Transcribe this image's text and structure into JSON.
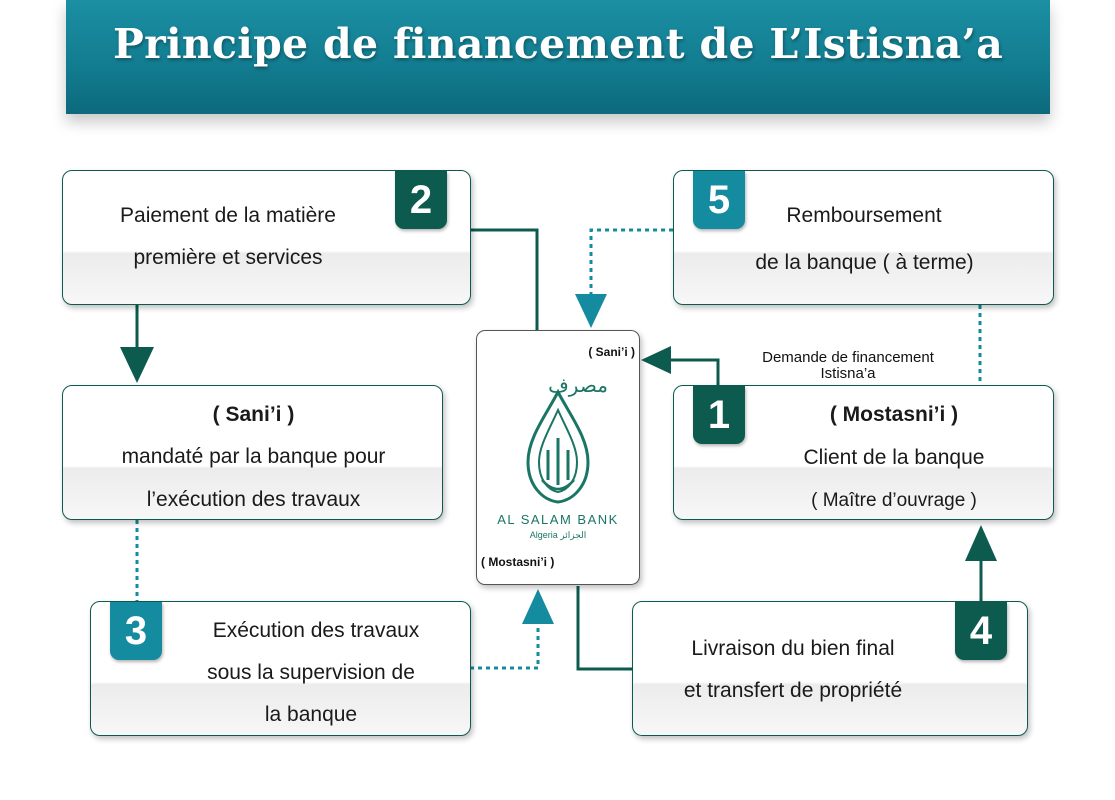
{
  "title": "Principe de financement de L’Istisna’a",
  "colors": {
    "banner": "#137d91",
    "dark_green": "#0d5b4e",
    "teal": "#158ba0"
  },
  "steps": {
    "s1": {
      "number": "1",
      "title": "( Mostasni’i )",
      "line1": "Client de la banque",
      "line2": "( Maître d’ouvrage )"
    },
    "s2": {
      "number": "2",
      "line1": "Paiement de la matière",
      "line2": "première et services"
    },
    "s3": {
      "number": "3",
      "line1": "Exécution des travaux",
      "line2": "sous la supervision de",
      "line3": "la banque"
    },
    "s4": {
      "number": "4",
      "line1": "Livraison du bien final",
      "line2": "et transfert de propriété"
    },
    "s5": {
      "number": "5",
      "line1": "Remboursement",
      "line2": "de la banque ( à terme)"
    }
  },
  "sani": {
    "title": "( Sani’i )",
    "line1": "mandaté par la banque pour",
    "line2": "l’exécution des travaux"
  },
  "bank": {
    "label_sani": "( Sani’i )",
    "label_mostasni": "( Mostasni’i )",
    "arabic_name": "مصرف",
    "name": "AL SALAM BANK",
    "country": "Algeria",
    "country_ar": "الجزائر"
  },
  "request_note": {
    "line1": "Demande de financement",
    "line2": "Istisna’a"
  }
}
